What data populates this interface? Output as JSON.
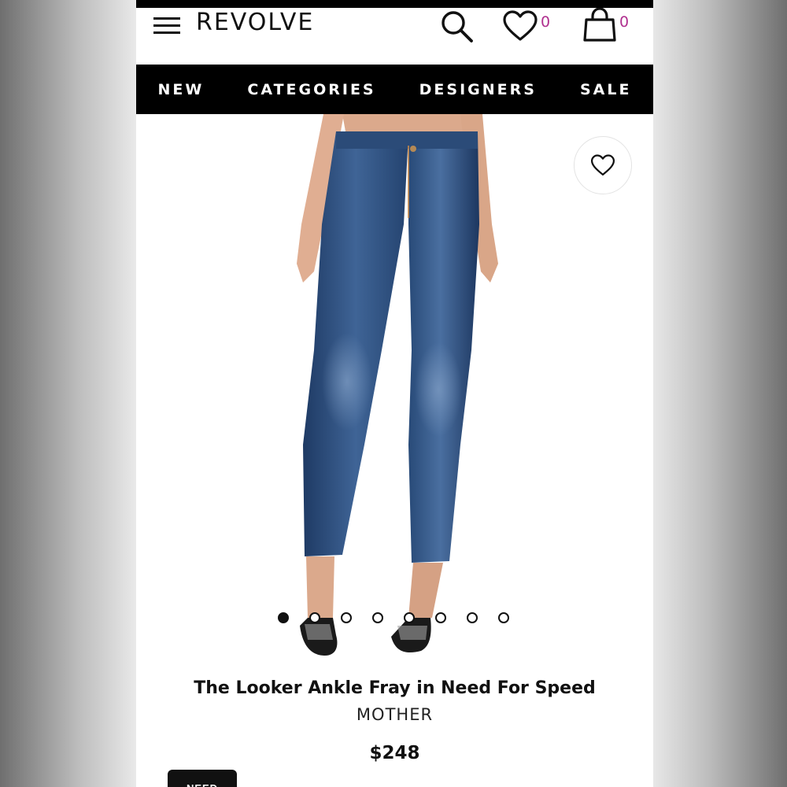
{
  "header": {
    "logo": "REVOLVE",
    "wishlist_count": "0",
    "bag_count": "0",
    "icons": {
      "menu": "hamburger-menu-icon",
      "search": "search-icon",
      "wishlist": "heart-icon",
      "bag": "shopping-bag-icon"
    },
    "count_color": "#b0308f"
  },
  "nav": {
    "items": [
      {
        "label": "NEW"
      },
      {
        "label": "CATEGORIES"
      },
      {
        "label": "DESIGNERS"
      },
      {
        "label": "SALE"
      }
    ]
  },
  "carousel": {
    "total": 8,
    "active_index": 0,
    "favorite_icon": "heart-outline-icon"
  },
  "product": {
    "title": "The Looker Ankle Fray in Need For Speed",
    "brand": "MOTHER",
    "price": "$248"
  },
  "badge": {
    "label": "NEED"
  }
}
